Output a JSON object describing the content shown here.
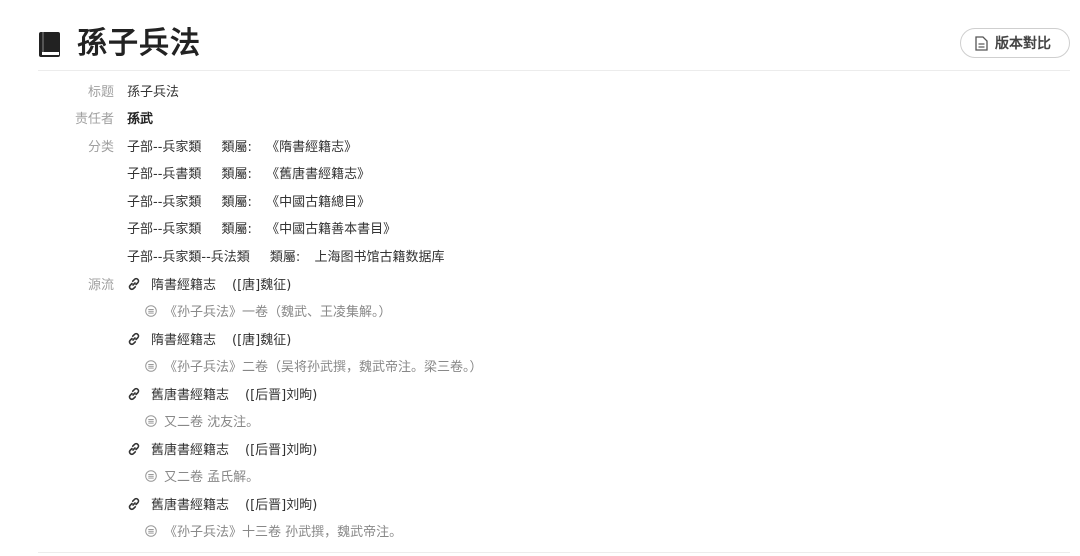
{
  "header": {
    "title": "孫子兵法",
    "compare_button": "版本對比"
  },
  "fields": {
    "title_label": "标题",
    "title_value": "孫子兵法",
    "author_label": "责任者",
    "author_value": "孫武",
    "category_label": "分类",
    "categories": [
      {
        "cat": "子部--兵家類",
        "belong_label": "類屬:",
        "source": "《隋書經籍志》"
      },
      {
        "cat": "子部--兵書類",
        "belong_label": "類屬:",
        "source": "《舊唐書經籍志》"
      },
      {
        "cat": "子部--兵家類",
        "belong_label": "類屬:",
        "source": "《中國古籍總目》"
      },
      {
        "cat": "子部--兵家類",
        "belong_label": "類屬:",
        "source": "《中國古籍善本書目》"
      },
      {
        "cat": "子部--兵家類--兵法類",
        "belong_label": "類屬:",
        "source": "上海图书馆古籍数据库"
      }
    ],
    "origin_label": "源流",
    "origins": [
      {
        "book": "隋書經籍志",
        "author": "([唐]魏征)",
        "note": "《孙子兵法》一卷（魏武、王凌集解。）"
      },
      {
        "book": "隋書經籍志",
        "author": "([唐]魏征)",
        "note": "《孙子兵法》二卷（吴将孙武撰，魏武帝注。梁三卷。）"
      },
      {
        "book": "舊唐書經籍志",
        "author": "([后晋]刘昫)",
        "note": "又二卷 沈友注。"
      },
      {
        "book": "舊唐書經籍志",
        "author": "([后晋]刘昫)",
        "note": "又二卷 孟氏解。"
      },
      {
        "book": "舊唐書經籍志",
        "author": "([后晋]刘昫)",
        "note": "《孙子兵法》十三卷 孙武撰，魏武帝注。"
      }
    ]
  }
}
